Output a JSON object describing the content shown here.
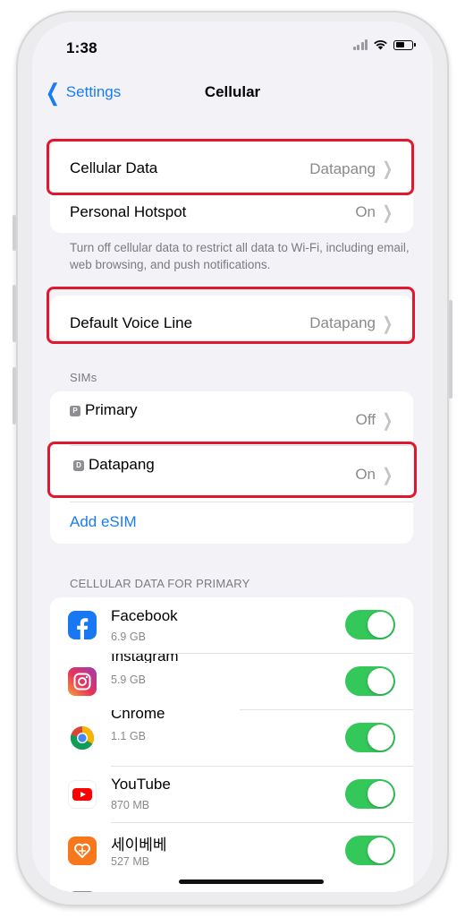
{
  "status_bar": {
    "time": "1:38"
  },
  "nav": {
    "back_label": "Settings",
    "title": "Cellular"
  },
  "cellular_group": {
    "cellular_data": {
      "label": "Cellular Data",
      "value": "Datapang"
    },
    "personal_hotspot": {
      "label": "Personal Hotspot",
      "value": "On"
    }
  },
  "cellular_note": "Turn off cellular data to restrict all data to Wi-Fi, including email, web browsing, and push notifications.",
  "voice_line": {
    "label": "Default Voice Line",
    "value": "Datapang"
  },
  "sims": {
    "header": "SIMs",
    "primary": {
      "badge": "P",
      "label": "Primary",
      "value": "Off"
    },
    "datapang": {
      "badge": "D",
      "label": "Datapang",
      "value": "On"
    },
    "add_esim": "Add eSIM"
  },
  "apps_section": {
    "header": "CELLULAR DATA FOR PRIMARY",
    "apps": [
      {
        "name": "Facebook",
        "size": "6.9 GB",
        "enabled": true,
        "icon": "facebook-icon",
        "color": "#1877f2"
      },
      {
        "name": "Instagram",
        "size": "5.9 GB",
        "enabled": true,
        "icon": "instagram-icon",
        "color": "#d62976"
      },
      {
        "name": "Chrome",
        "size": "1.1 GB",
        "enabled": true,
        "icon": "chrome-icon",
        "color": "#4285f4"
      },
      {
        "name": "YouTube",
        "size": "870 MB",
        "enabled": true,
        "icon": "youtube-icon",
        "color": "#ff0000"
      },
      {
        "name": "세이베베",
        "size": "527 MB",
        "enabled": true,
        "icon": "heart-icon",
        "color": "#f7771d"
      }
    ]
  },
  "colors": {
    "accent": "#1a7cf5",
    "toggle_on": "#34c759",
    "highlight": "#e1182d"
  }
}
